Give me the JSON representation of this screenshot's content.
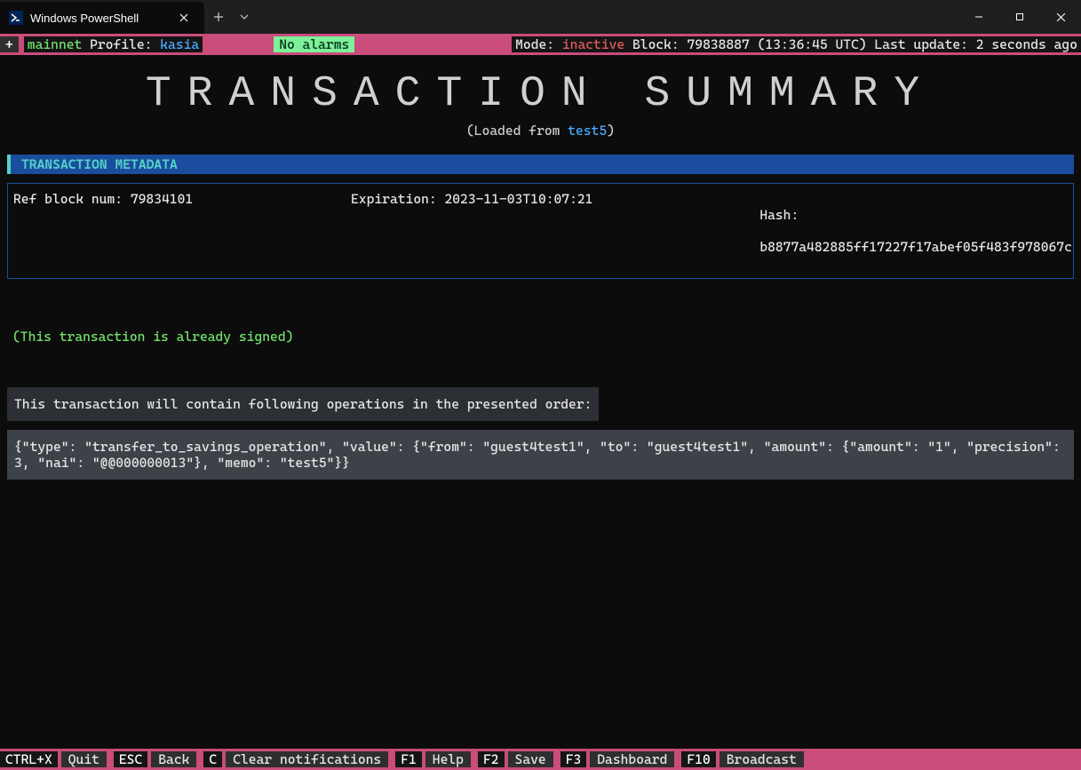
{
  "window": {
    "tab_title": "Windows PowerShell"
  },
  "status": {
    "plus": "+",
    "network": "mainnet",
    "profile_label": "Profile:",
    "profile_value": "kasia",
    "alarms": "No alarms",
    "mode_label": "Mode:",
    "mode_value": "inactive",
    "block_label": "Block:",
    "block_value": "79838887 (13:36:45 UTC)",
    "update_label": "Last update:",
    "update_value": "2 seconds ago"
  },
  "title": "TRANSACTION SUMMARY",
  "loaded": {
    "prefix": "(Loaded from ",
    "name": "test5",
    "suffix": ")"
  },
  "section_header": "TRANSACTION METADATA",
  "meta": {
    "ref": "Ref block num: 79834101",
    "exp": "Expiration: 2023-11-03T10:07:21",
    "hash_label": "Hash:",
    "hash_value": "b8877a482885ff17227f17abef05f483f978067c"
  },
  "signed": "(This transaction is already signed)",
  "ops_header": "This transaction will contain following operations in the presented order:",
  "ops_body": "{\"type\": \"transfer_to_savings_operation\", \"value\": {\"from\": \"guest4test1\", \"to\": \"guest4test1\", \"amount\": {\"amount\": \"1\", \"precision\": 3, \"nai\": \"@@000000013\"}, \"memo\": \"test5\"}}",
  "keys": [
    {
      "key": "CTRL+X",
      "label": "Quit"
    },
    {
      "key": "ESC",
      "label": "Back"
    },
    {
      "key": "C",
      "label": "Clear notifications"
    },
    {
      "key": "F1",
      "label": "Help"
    },
    {
      "key": "F2",
      "label": "Save"
    },
    {
      "key": "F3",
      "label": "Dashboard"
    },
    {
      "key": "F10",
      "label": "Broadcast"
    }
  ]
}
